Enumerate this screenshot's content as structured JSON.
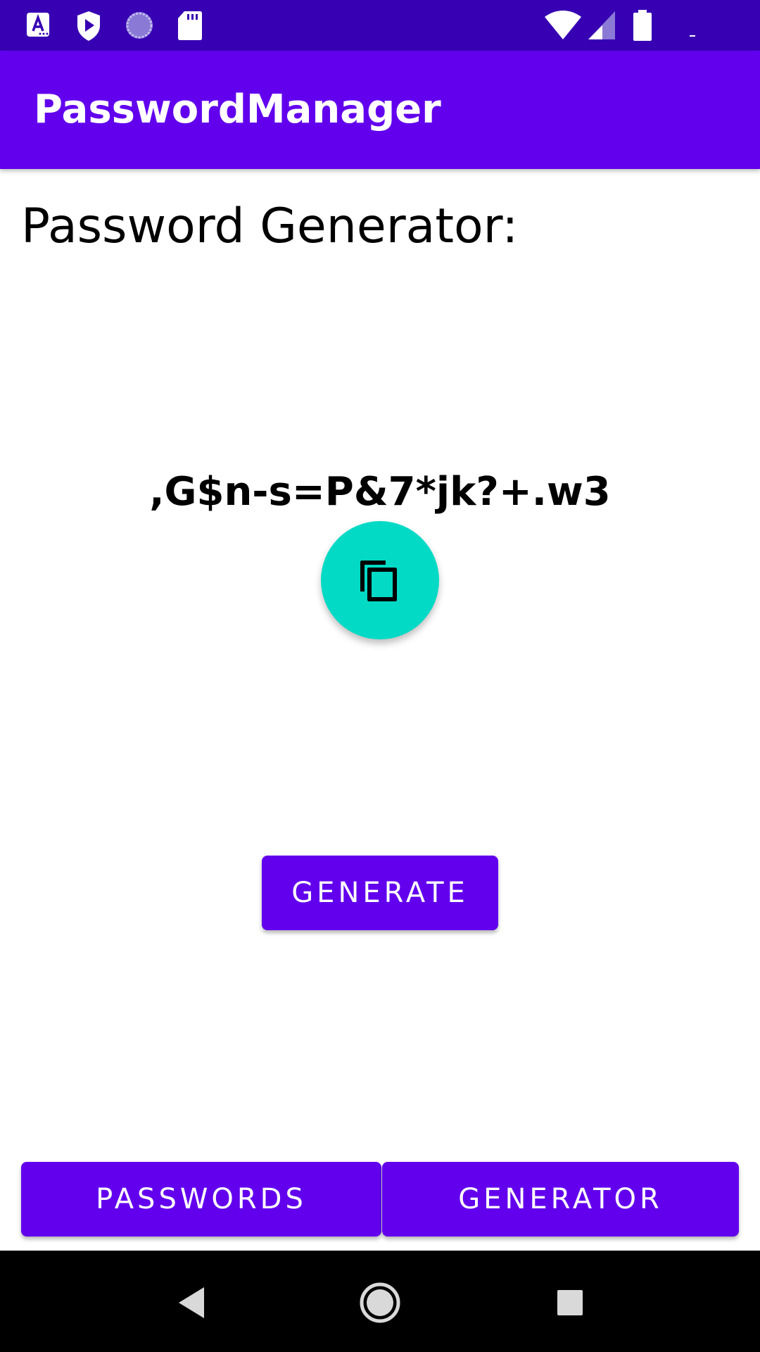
{
  "app": {
    "title": "PasswordManager",
    "colors": {
      "status_bar": "#3700b3",
      "primary": "#6200ee",
      "accent": "#03dac5",
      "nav_bar": "#000000"
    }
  },
  "status_bar": {
    "left_icons": [
      "app-a-icon",
      "play-shield-icon",
      "loading-circle-icon",
      "sd-card-icon"
    ],
    "right_icons": [
      "wifi-icon",
      "cell-signal-icon",
      "battery-icon"
    ]
  },
  "content": {
    "heading": "Password Generator:",
    "generated_password": ",G$n-s=P&7*jk?+.w3",
    "copy_button_icon": "copy-icon",
    "generate_label": "GENERATE"
  },
  "bottom_buttons": {
    "passwords_label": "PASSWORDS",
    "generator_label": "GENERATOR"
  },
  "nav_bar": {
    "icons": [
      "back-icon",
      "home-icon",
      "recents-icon"
    ]
  }
}
